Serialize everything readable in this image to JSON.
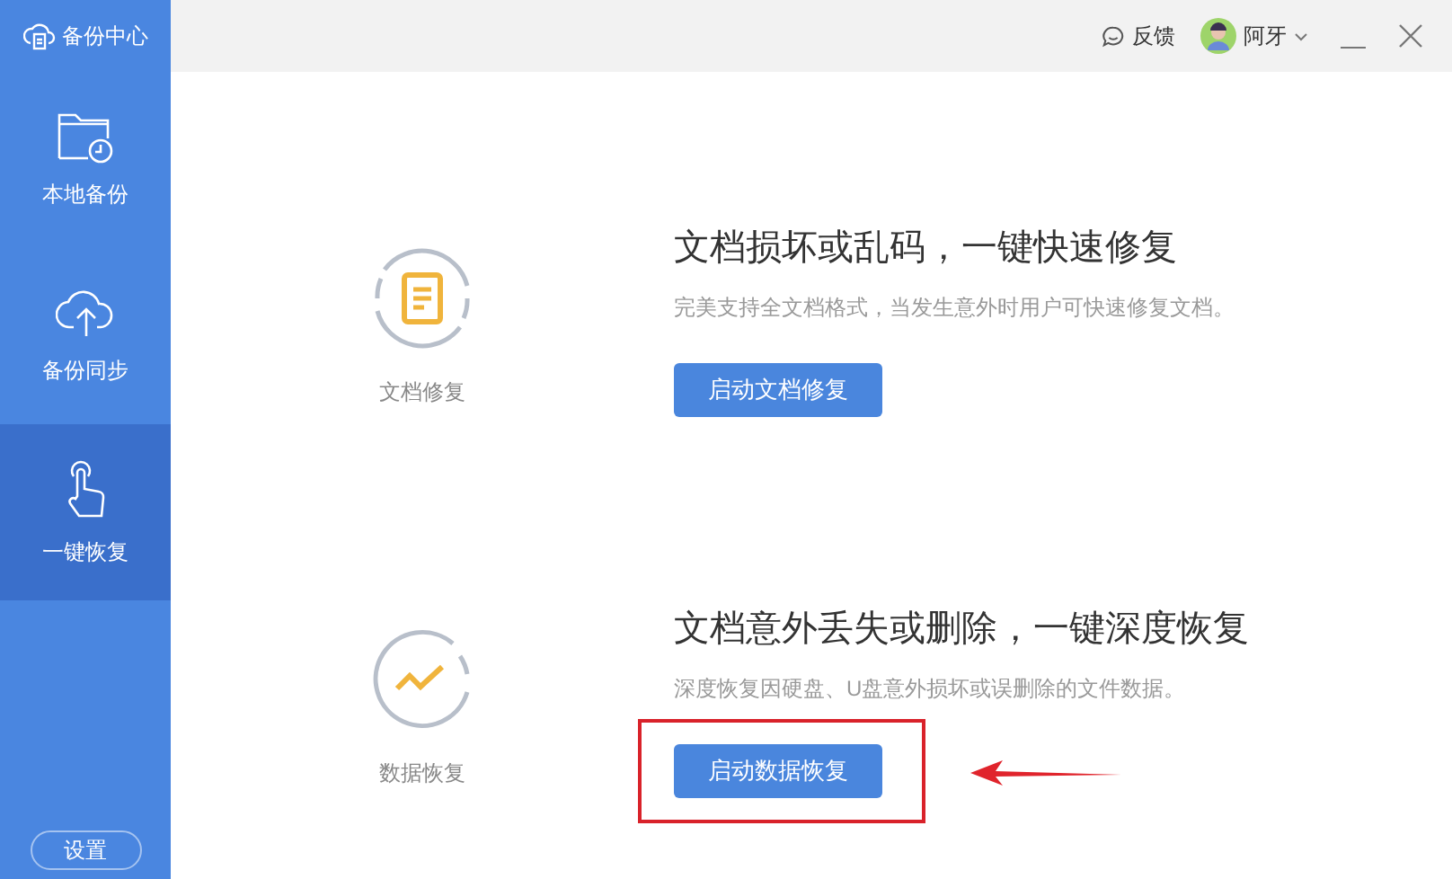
{
  "sidebar": {
    "title": "备份中心",
    "items": [
      {
        "kind": "local",
        "label": "本地备份",
        "selected": false
      },
      {
        "kind": "sync",
        "label": "备份同步",
        "selected": false
      },
      {
        "kind": "restore",
        "label": "一键恢复",
        "selected": true
      }
    ],
    "settings": "设置"
  },
  "topbar": {
    "feedback": "反馈",
    "user": "阿牙"
  },
  "sections": [
    {
      "kind": "doc",
      "icon_label": "文档修复",
      "title": "文档损坏或乱码，一键快速修复",
      "description": "完美支持全文档格式，当发生意外时用户可快速修复文档。",
      "button": "启动文档修复",
      "highlighted": false
    },
    {
      "kind": "data",
      "icon_label": "数据恢复",
      "title": "文档意外丢失或删除，一键深度恢复",
      "description": "深度恢复因硬盘、U盘意外损坏或误删除的文件数据。",
      "button": "启动数据恢复",
      "highlighted": true
    }
  ]
}
